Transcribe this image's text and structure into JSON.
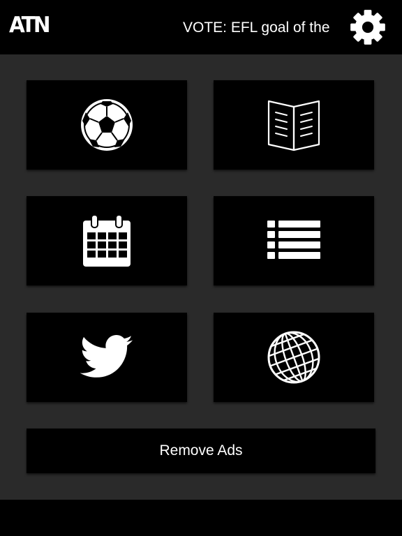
{
  "header": {
    "logo_text": "ATN",
    "ticker_text": "VOTE: EFL goal of the",
    "settings_icon": "gear-icon"
  },
  "tiles": [
    {
      "name": "scores",
      "icon": "soccer-ball-icon"
    },
    {
      "name": "news",
      "icon": "open-book-icon"
    },
    {
      "name": "fixtures",
      "icon": "calendar-icon"
    },
    {
      "name": "tables",
      "icon": "list-icon"
    },
    {
      "name": "twitter",
      "icon": "twitter-bird-icon"
    },
    {
      "name": "web",
      "icon": "globe-icon"
    }
  ],
  "remove_ads": {
    "label": "Remove Ads"
  },
  "colors": {
    "background": "#2a2a2a",
    "bar": "#000000",
    "tile": "#000000",
    "text": "#ffffff"
  }
}
